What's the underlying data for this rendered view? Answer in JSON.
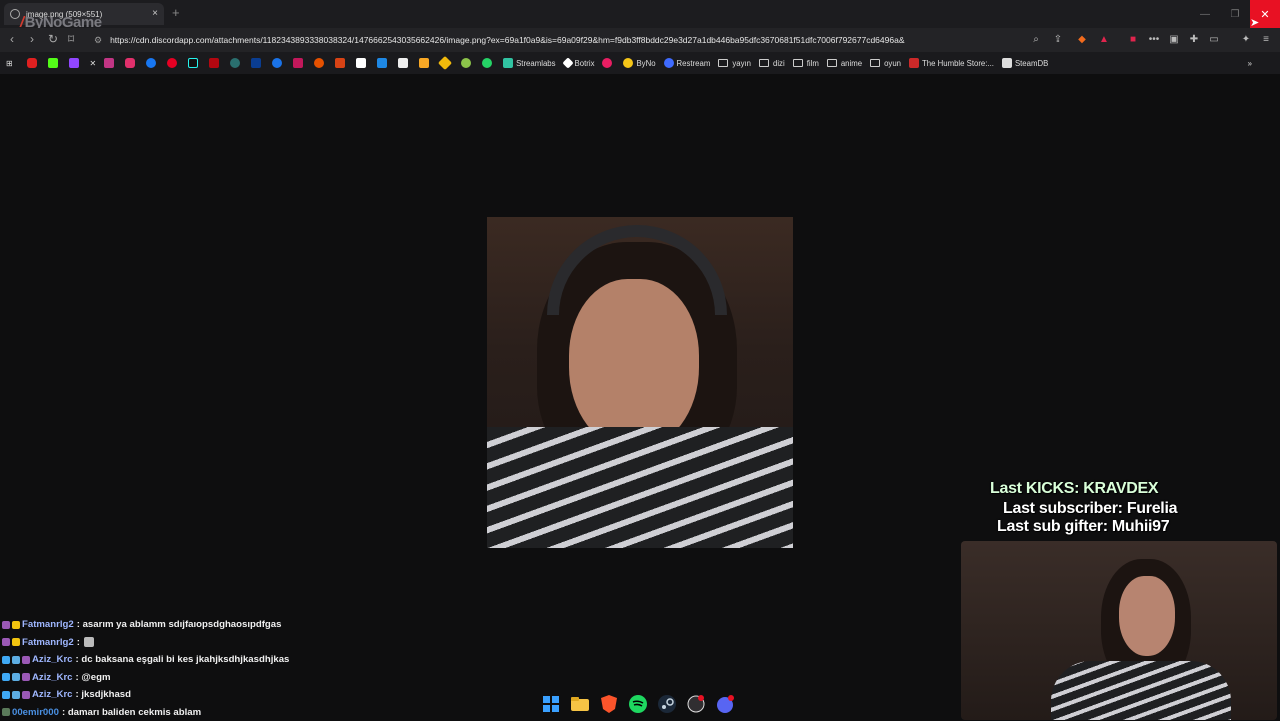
{
  "browser": {
    "tab_title": "image.png (509×551)",
    "tab_close": "×",
    "new_tab": "+",
    "url": "https://cdn.discordapp.com/attachments/1182343893338038324/1476662543035662426/image.png?ex=69a1f0a9&is=69a09f29&hm=f9db3ff8bddc29e3d27a1db446ba95dfc3670681f51dfc7006f792677cd6496a&",
    "window_close": "✕",
    "window_min": "—",
    "window_max": "❐"
  },
  "watermark": {
    "slash": "/",
    "text": "ByNoGame"
  },
  "bookmarks": [
    {
      "label": "Streamlabs"
    },
    {
      "label": "Botrix"
    },
    {
      "label": "ByNo"
    },
    {
      "label": "Restream"
    },
    {
      "label": "yayın"
    },
    {
      "label": "dizi"
    },
    {
      "label": "film"
    },
    {
      "label": "anime"
    },
    {
      "label": "oyun"
    },
    {
      "label": "The Humble Store:..."
    },
    {
      "label": "SteamDB"
    }
  ],
  "overlay": {
    "kicks": "Last KICKS: KRAVDEX",
    "subscriber": "Last subscriber: Furelia",
    "gifter": "Last sub gifter: Muhii97"
  },
  "chat": [
    {
      "user": "Fatmanrlg2",
      "text": ": asarım ya ablamm sdıjfaıopsdghaosıpdfgas"
    },
    {
      "user": "Fatmanrlg2",
      "text": ":"
    },
    {
      "user": "Aziz_Krc",
      "text": ": dc baksana eşgali bi kes jkahjksdhjkasdhjkas"
    },
    {
      "user": "Aziz_Krc",
      "text": ": @egm"
    },
    {
      "user": "Aziz_Krc",
      "text": ": jksdjkhasd"
    },
    {
      "user": "00emir000",
      "text": ": damarı baliden cekmis ablam"
    }
  ],
  "colors": {
    "accent_red": "#e81123",
    "chat_user": "#9fb7ff"
  }
}
